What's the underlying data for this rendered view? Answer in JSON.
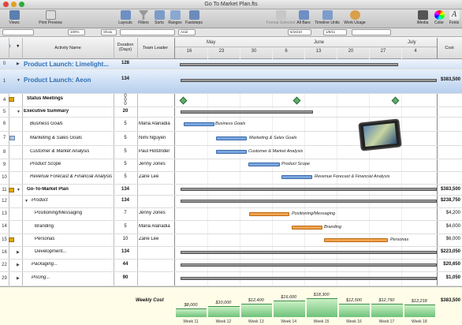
{
  "window": {
    "title": "Go To Market Plan.fts"
  },
  "toolbar": {
    "views": "Views",
    "print_preview": "Print Preview",
    "layouts": "Layouts",
    "filters": "Filters",
    "sorts": "Sorts",
    "ranges": "Ranges",
    "faststeps": "Faststeps",
    "format_selected": "Format Selected",
    "all_bars": "All Bars",
    "timeline_units": "Timeline Units",
    "work_usage": "Work Usage",
    "imedia": "iMedia",
    "color": "Color",
    "fonts": "Fonts"
  },
  "format_bar": {
    "font_size": "Arial",
    "zoom": "100%",
    "show": "Show",
    "start_date": "5/16/10",
    "end_date": "1/8/11"
  },
  "columns": {
    "activity": "Activity Name",
    "duration": "Duration (Days)",
    "leader": "Team Leader",
    "cost": "Cost"
  },
  "timeline": {
    "months": [
      "May",
      "June",
      "July"
    ],
    "weeks": [
      "16",
      "23",
      "30",
      "6",
      "13",
      "20",
      "27",
      "4"
    ]
  },
  "rows": [
    {
      "num": "0",
      "name": "Product Launch: Limelight...",
      "duration": "128",
      "leader": "",
      "cost": ""
    },
    {
      "num": "1",
      "name": "Product Launch: Aeon",
      "duration": "134",
      "leader": "",
      "cost": "$383,500"
    },
    {
      "num": "4",
      "name": "Status Meetings",
      "duration": "0",
      "duration2": "0",
      "duration3": "0",
      "leader": "",
      "cost": ""
    },
    {
      "num": "5",
      "name": "Executive Summary",
      "duration": "20",
      "leader": "",
      "cost": ""
    },
    {
      "num": "6",
      "name": "Business Goals",
      "duration": "5",
      "leader": "Maria Alanadia",
      "cost": ""
    },
    {
      "num": "7",
      "name": "Marketing & Sales Goals",
      "duration": "5",
      "leader": "Nimi Nguyen",
      "cost": ""
    },
    {
      "num": "8",
      "name": "Customer & Market Analysis",
      "duration": "5",
      "leader": "Paul Holstrider",
      "cost": ""
    },
    {
      "num": "9",
      "name": "Product Scope",
      "duration": "5",
      "leader": "Jenny Jones",
      "cost": ""
    },
    {
      "num": "10",
      "name": "Revenue Forecast & Financial Analysis",
      "duration": "5",
      "leader": "Zane Lee",
      "cost": ""
    },
    {
      "num": "11",
      "name": "Go-To-Market Plan",
      "duration": "134",
      "leader": "",
      "cost": "$383,500"
    },
    {
      "num": "12",
      "name": "Product",
      "duration": "134",
      "leader": "",
      "cost": "$238,750"
    },
    {
      "num": "13",
      "name": "Positioning/Messaging",
      "duration": "7",
      "leader": "Jenny Jones",
      "cost": "$4,200"
    },
    {
      "num": "14",
      "name": "Branding",
      "duration": "5",
      "leader": "Maria Alanadia",
      "cost": "$4,000"
    },
    {
      "num": "15",
      "name": "Personas",
      "duration": "10",
      "leader": "Zane Lee",
      "cost": "$6,000"
    },
    {
      "num": "16",
      "name": "Development...",
      "duration": "134",
      "leader": "",
      "cost": "$223,050"
    },
    {
      "num": "22",
      "name": "Packaging...",
      "duration": "44",
      "leader": "",
      "cost": "$20,650"
    },
    {
      "num": "29",
      "name": "Pricing...",
      "duration": "90",
      "leader": "",
      "cost": "$1,050"
    }
  ],
  "bar_labels": {
    "business": "Business Goals",
    "marketing": "Marketing & Sales Goals",
    "customer": "Customer & Market Analysis",
    "scope": "Product Scope",
    "revenue": "Revenue Forecast & Financial Analysis",
    "positioning": "Positioning/Messaging",
    "branding": "Branding",
    "personas": "Personas"
  },
  "weekly": {
    "title": "Weekly Cost",
    "total": "$383,500",
    "values": [
      "$8,000",
      "$10,000",
      "$12,400",
      "$16,600",
      "$18,300",
      "$12,500",
      "$12,750",
      "$12,218"
    ],
    "levels": [
      0.35,
      0.45,
      0.55,
      0.7,
      0.8,
      0.55,
      0.56,
      0.54
    ],
    "weeks": [
      "Week 11",
      "Week 12",
      "Week 13",
      "Week 14",
      "Week 15",
      "Week 16",
      "Week 17",
      "Week 18"
    ]
  },
  "colors": {
    "accent_blue": "#2f6fb5",
    "task_blue": "#7aa6df",
    "task_orange": "#f2a24c",
    "milestone_green": "#5fae6c"
  }
}
